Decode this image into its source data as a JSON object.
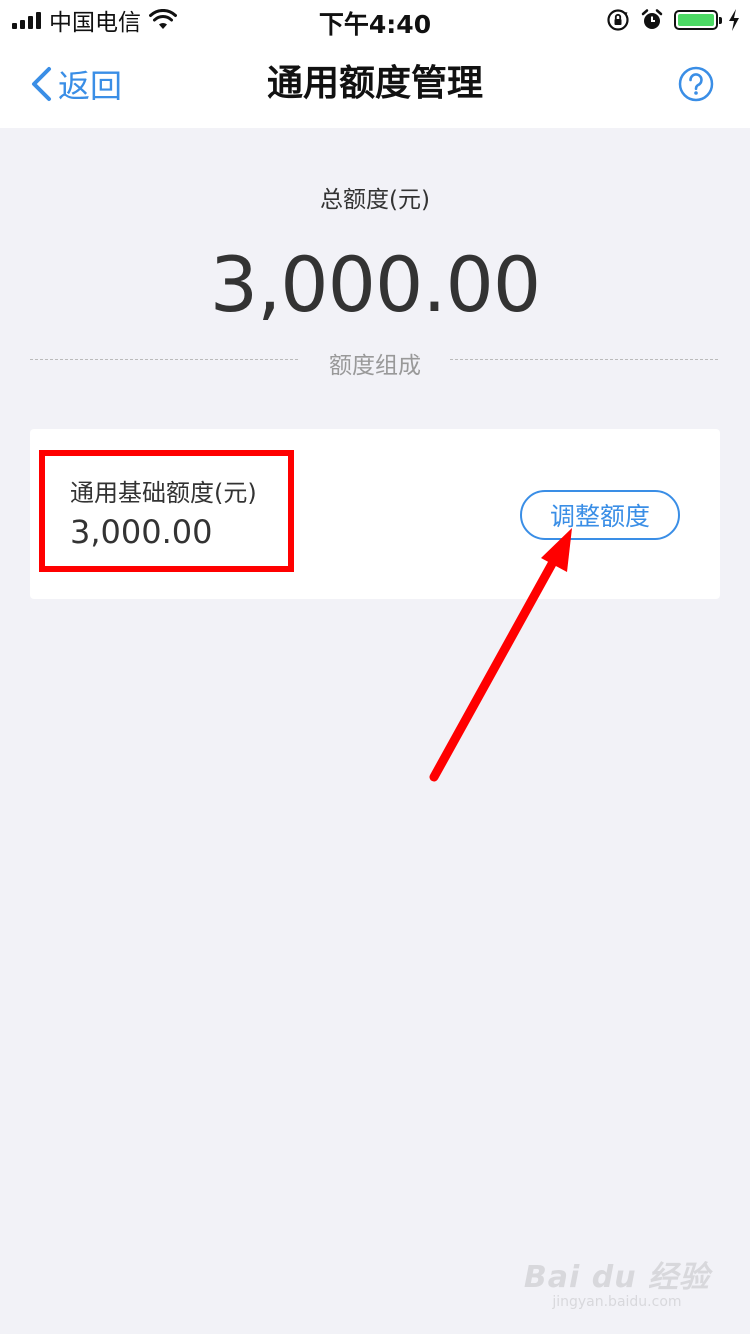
{
  "status_bar": {
    "carrier": "中国电信",
    "time": "下午4:40",
    "icons": [
      "signal-icon",
      "wifi-icon",
      "orientation-lock-icon",
      "alarm-icon",
      "battery-icon",
      "charging-icon"
    ],
    "battery_color": "#4cd964"
  },
  "nav": {
    "back_label": "返回",
    "title": "通用额度管理",
    "help_icon": "help-icon"
  },
  "summary": {
    "total_label": "总额度(元)",
    "total_value": "3,000.00",
    "composition_label": "额度组成"
  },
  "card": {
    "label": "通用基础额度(元)",
    "value": "3,000.00",
    "adjust_button": "调整额度"
  },
  "colors": {
    "accent": "#3a8ee6",
    "background": "#f2f2f7",
    "annotation": "#ff0000"
  },
  "watermark": {
    "logo": "Bai du 经验",
    "url": "jingyan.baidu.com"
  }
}
